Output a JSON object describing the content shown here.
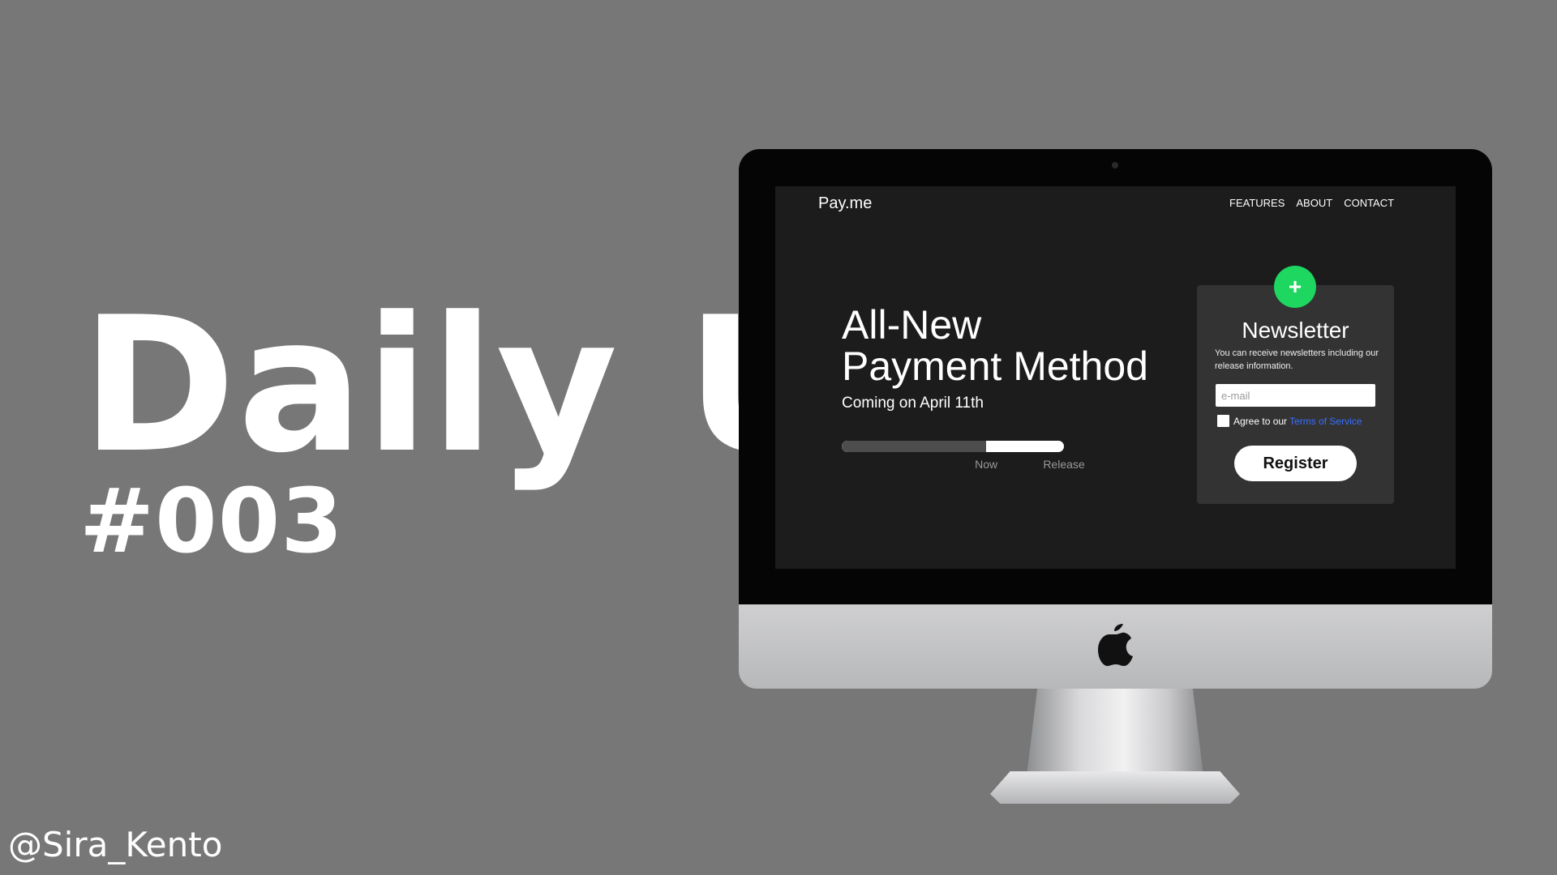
{
  "poster": {
    "title": "Daily UI",
    "number": "#003",
    "author": "@Sira_Kento"
  },
  "site": {
    "brand": "Pay.me",
    "nav": [
      "FEATURES",
      "ABOUT",
      "CONTACT"
    ],
    "hero": {
      "title_line1": "All-New",
      "title_line2": "Payment Method",
      "subtitle": "Coming on April 11th"
    },
    "progress": {
      "fraction": 0.65,
      "label_now": "Now",
      "label_release": "Release"
    },
    "newsletter": {
      "plus_symbol": "+",
      "title": "Newsletter",
      "description": "You can receive newsletters including our release information.",
      "email_placeholder": "e-mail",
      "agree_text": "Agree to our",
      "tos_link": "Terms of Service",
      "register_label": "Register"
    }
  },
  "colors": {
    "background": "#777777",
    "screen": "#1c1c1c",
    "card": "#333333",
    "accent_green": "#1ed760",
    "link_blue": "#3a6fff"
  },
  "icons": {
    "apple": "apple-logo-icon",
    "plus": "plus-icon"
  }
}
